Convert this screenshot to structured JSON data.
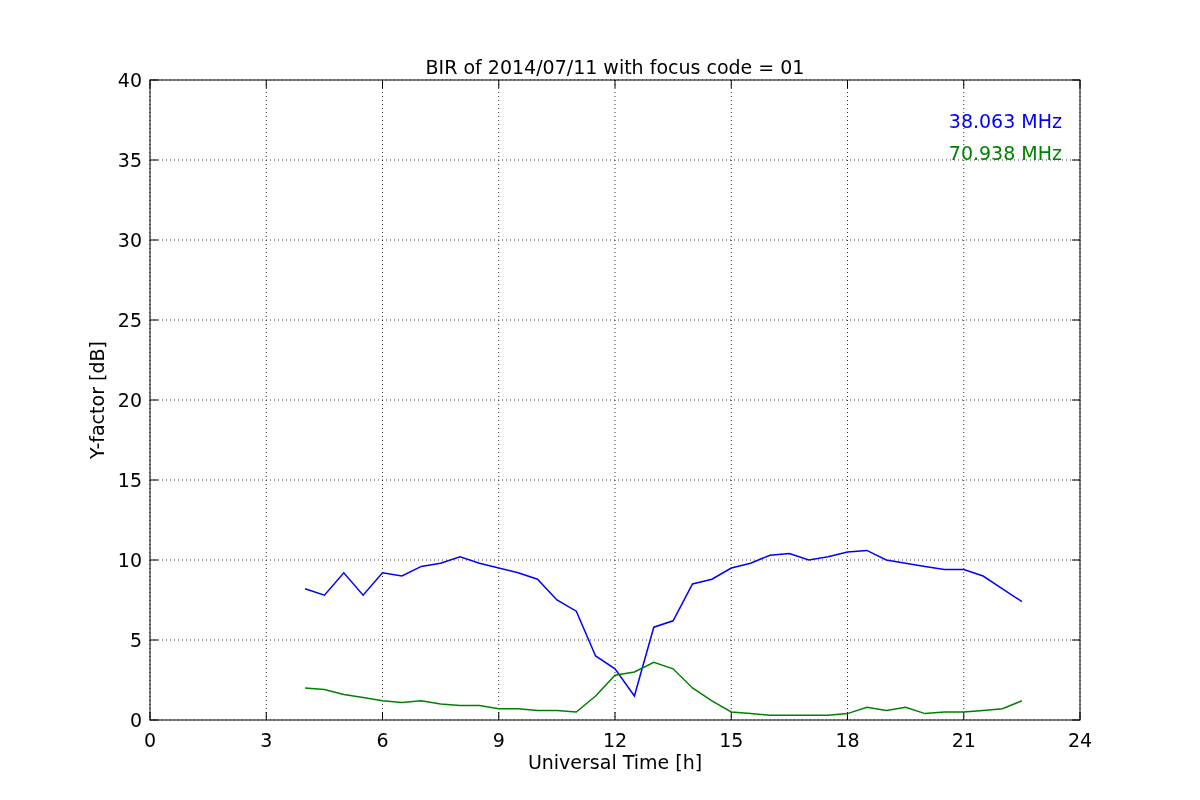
{
  "chart_data": {
    "type": "line",
    "title": "BIR of 2014/07/11 with focus code = 01",
    "xlabel": "Universal Time [h]",
    "ylabel": "Y-factor [dB]",
    "x": [
      4.0,
      4.5,
      5.0,
      5.5,
      6.0,
      6.5,
      7.0,
      7.5,
      8.0,
      8.5,
      9.0,
      9.5,
      10.0,
      10.5,
      11.0,
      11.5,
      12.0,
      12.5,
      13.0,
      13.5,
      14.0,
      14.5,
      15.0,
      15.5,
      16.0,
      16.5,
      17.0,
      17.5,
      18.0,
      18.5,
      19.0,
      19.5,
      20.0,
      20.5,
      21.0,
      21.5,
      22.0,
      22.5
    ],
    "series": [
      {
        "name": "38.063 MHz",
        "color": "#0000ff",
        "values": [
          8.2,
          7.8,
          9.2,
          7.8,
          9.2,
          9.0,
          9.6,
          9.8,
          10.2,
          9.8,
          9.5,
          9.2,
          8.8,
          7.5,
          6.8,
          4.0,
          3.2,
          1.5,
          5.8,
          6.2,
          8.5,
          8.8,
          9.5,
          9.8,
          10.3,
          10.4,
          10.0,
          10.2,
          10.5,
          10.6,
          10.0,
          9.8,
          9.6,
          9.4,
          9.4,
          9.0,
          8.2,
          7.4
        ]
      },
      {
        "name": "70.938 MHz",
        "color": "#008000",
        "values": [
          2.0,
          1.9,
          1.6,
          1.4,
          1.2,
          1.1,
          1.2,
          1.0,
          0.9,
          0.9,
          0.7,
          0.7,
          0.6,
          0.6,
          0.5,
          1.5,
          2.8,
          3.0,
          3.6,
          3.2,
          2.0,
          1.2,
          0.5,
          0.4,
          0.3,
          0.3,
          0.3,
          0.3,
          0.4,
          0.8,
          0.6,
          0.8,
          0.4,
          0.5,
          0.5,
          0.6,
          0.7,
          1.2
        ]
      }
    ],
    "xlim": [
      0,
      24
    ],
    "ylim": [
      0,
      40
    ],
    "xticks": [
      0,
      3,
      6,
      9,
      12,
      15,
      18,
      21,
      24
    ],
    "yticks": [
      0,
      5,
      10,
      15,
      20,
      25,
      30,
      35,
      40
    ],
    "grid": true
  }
}
